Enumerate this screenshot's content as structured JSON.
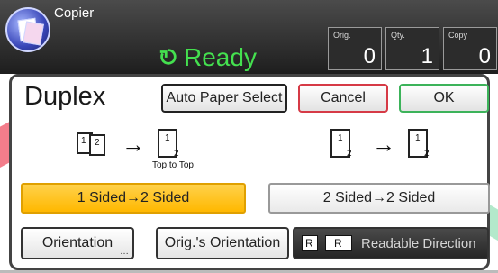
{
  "header": {
    "app_title": "Copier",
    "status": "Ready",
    "counters": [
      {
        "label": "Orig.",
        "value": "0"
      },
      {
        "label": "Qty.",
        "value": "1"
      },
      {
        "label": "Copy",
        "value": "0"
      }
    ]
  },
  "panel": {
    "title": "Duplex",
    "buttons": {
      "auto_paper_select": "Auto Paper Select",
      "cancel": "Cancel",
      "ok": "OK"
    },
    "top_to_top_label": "Top to Top",
    "options": [
      {
        "label": "1 Sided→2 Sided",
        "selected": true
      },
      {
        "label": "2 Sided→2 Sided",
        "selected": false
      }
    ],
    "bottom": {
      "orientation_label": "Orientation",
      "orig_orientation_label": "Orig.'s Orientation",
      "readable_direction_label": "Readable Direction"
    }
  },
  "colors": {
    "ready": "#44e04f",
    "selected_option": "#ffb800",
    "cancel_border": "#d63a46",
    "ok_border": "#3cb35a"
  },
  "icons": {
    "app": "copier-app-icon",
    "status": "ready-status-icon",
    "arrow": "right-arrow-icon",
    "page": "page-icon",
    "readable_direction": "readable-direction-icon"
  }
}
